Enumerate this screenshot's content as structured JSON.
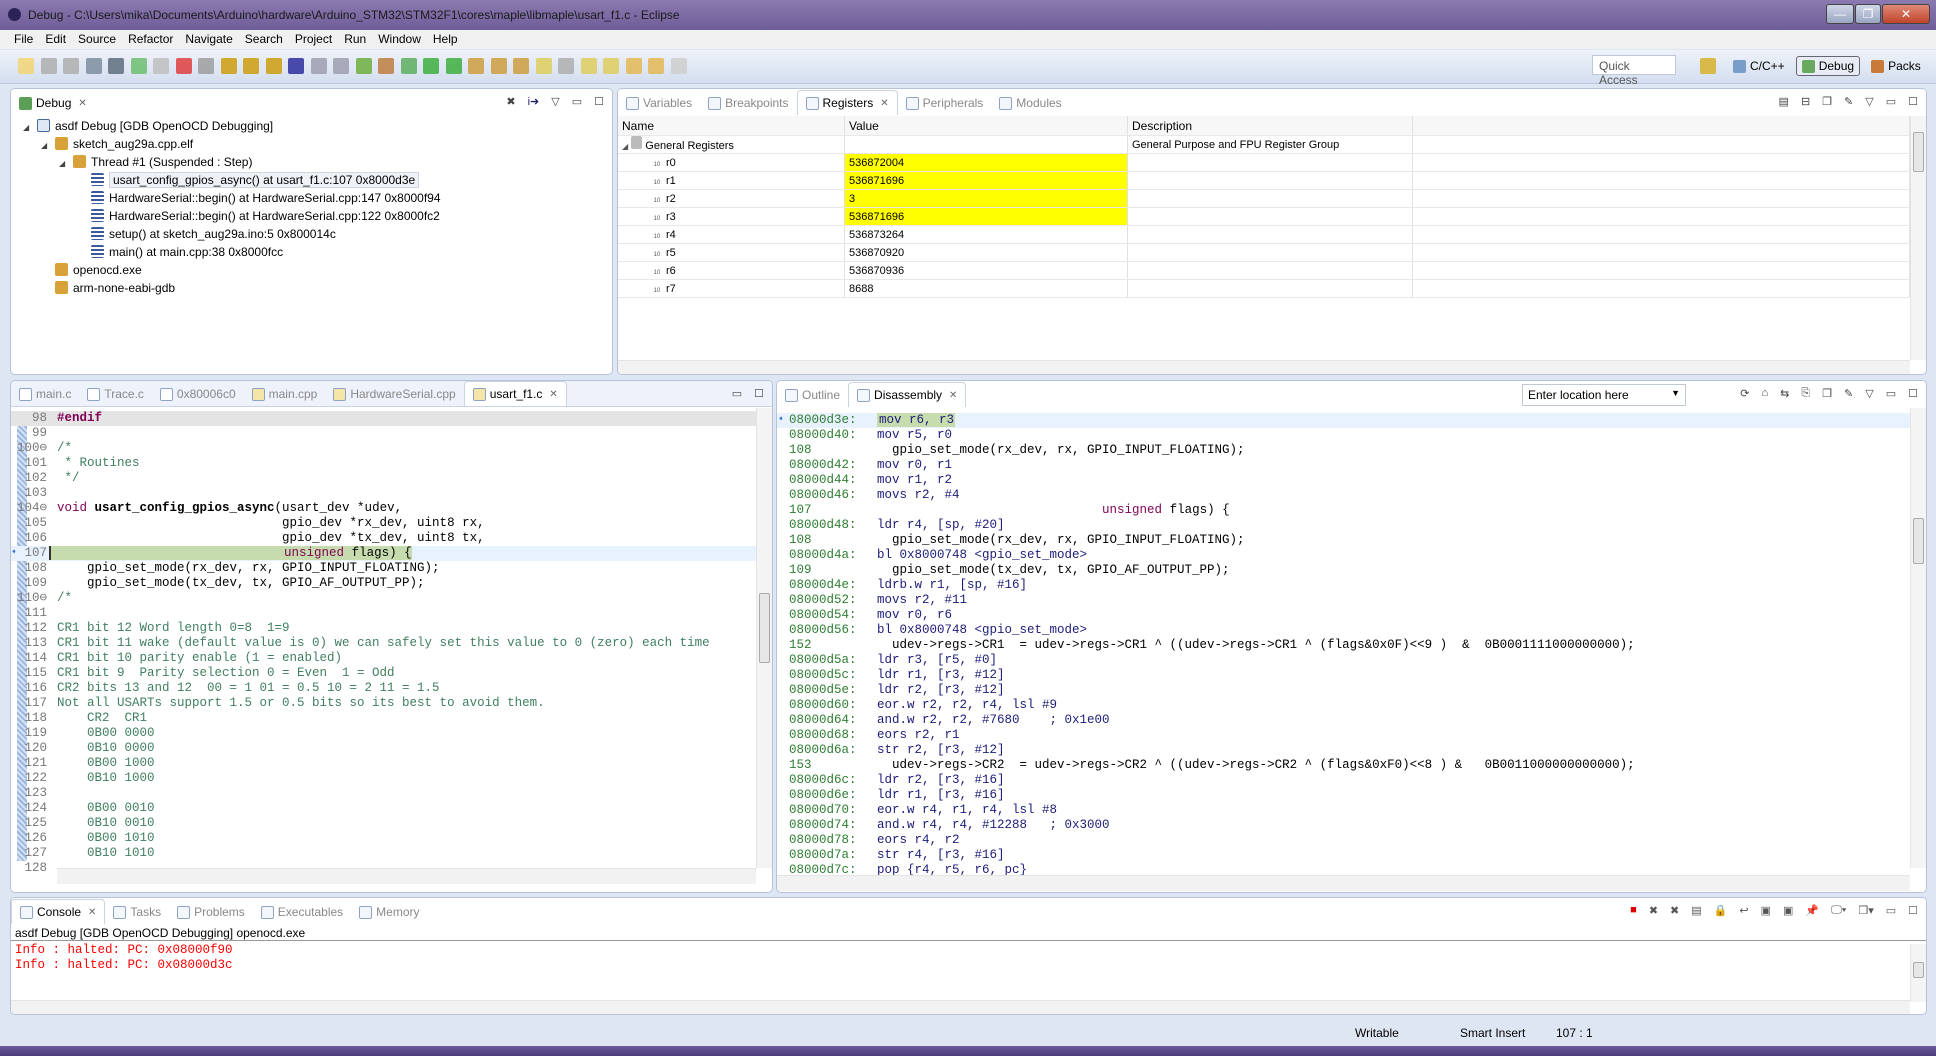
{
  "window": {
    "title": "Debug - C:\\Users\\mika\\Documents\\Arduino\\hardware\\Arduino_STM32\\STM32F1\\cores\\maple\\libmaple\\usart_f1.c - Eclipse",
    "minimize": "—",
    "restore": "❐",
    "close": "✕"
  },
  "menu": [
    "File",
    "Edit",
    "Source",
    "Refactor",
    "Navigate",
    "Search",
    "Project",
    "Run",
    "Window",
    "Help"
  ],
  "toolbar": {
    "quick_access_placeholder": "Quick Access",
    "perspectives": [
      {
        "label": "C/C++",
        "icon": "cpp-perspective-icon"
      },
      {
        "label": "Debug",
        "icon": "bug-icon",
        "active": true
      },
      {
        "label": "Packs",
        "icon": "packs-icon"
      }
    ]
  },
  "debug_view": {
    "tab": "Debug",
    "tree": [
      {
        "label": "asdf Debug [GDB OpenOCD Debugging]",
        "depth": 0,
        "icon": "c-launch-icon",
        "expanded": true
      },
      {
        "label": "sketch_aug29a.cpp.elf",
        "depth": 1,
        "icon": "process-icon",
        "expanded": true
      },
      {
        "label": "Thread #1 (Suspended : Step)",
        "depth": 2,
        "icon": "thread-icon",
        "expanded": true
      },
      {
        "label": "usart_config_gpios_async() at usart_f1.c:107 0x8000d3e",
        "depth": 3,
        "icon": "stack-frame-icon",
        "selected": true
      },
      {
        "label": "HardwareSerial::begin() at HardwareSerial.cpp:147 0x8000f94",
        "depth": 3,
        "icon": "stack-frame-icon"
      },
      {
        "label": "HardwareSerial::begin() at HardwareSerial.cpp:122 0x8000fc2",
        "depth": 3,
        "icon": "stack-frame-icon"
      },
      {
        "label": "setup() at sketch_aug29a.ino:5 0x800014c",
        "depth": 3,
        "icon": "stack-frame-icon"
      },
      {
        "label": "main() at main.cpp:38 0x8000fcc",
        "depth": 3,
        "icon": "stack-frame-icon"
      },
      {
        "label": "openocd.exe",
        "depth": 1,
        "icon": "process-icon"
      },
      {
        "label": "arm-none-eabi-gdb",
        "depth": 1,
        "icon": "process-icon"
      }
    ]
  },
  "registers_view": {
    "tabs": [
      {
        "label": "Variables",
        "icon": "variables-icon"
      },
      {
        "label": "Breakpoints",
        "icon": "breakpoints-icon"
      },
      {
        "label": "Registers",
        "icon": "registers-icon",
        "active": true
      },
      {
        "label": "Peripherals",
        "icon": "peripherals-icon"
      },
      {
        "label": "Modules",
        "icon": "modules-icon"
      }
    ],
    "columns": [
      "Name",
      "Value",
      "Description"
    ],
    "group": {
      "name": "General Registers",
      "description": "General Purpose and FPU Register Group"
    },
    "rows": [
      {
        "name": "r0",
        "value": "536872004",
        "changed": true
      },
      {
        "name": "r1",
        "value": "536871696",
        "changed": true
      },
      {
        "name": "r2",
        "value": "3",
        "changed": true
      },
      {
        "name": "r3",
        "value": "536871696",
        "changed": true
      },
      {
        "name": "r4",
        "value": "536873264"
      },
      {
        "name": "r5",
        "value": "536870920"
      },
      {
        "name": "r6",
        "value": "536870936"
      },
      {
        "name": "r7",
        "value": "8688"
      }
    ],
    "highlight_color": "#ffff00"
  },
  "editor": {
    "tabs": [
      {
        "label": "main.c"
      },
      {
        "label": "Trace.c"
      },
      {
        "label": "0x80006c0"
      },
      {
        "label": "main.cpp"
      },
      {
        "label": "HardwareSerial.cpp"
      },
      {
        "label": "usart_f1.c",
        "active": true
      }
    ],
    "current_line": 107,
    "lines": [
      {
        "n": "98",
        "segs": [
          [
            "#endif",
            "pp"
          ]
        ]
      },
      {
        "n": "99",
        "segs": []
      },
      {
        "n": "100⊖",
        "segs": [
          [
            "/*",
            "cm"
          ]
        ]
      },
      {
        "n": "101",
        "segs": [
          [
            " * Routines",
            "cm"
          ]
        ]
      },
      {
        "n": "102",
        "segs": [
          [
            " */",
            "cm"
          ]
        ]
      },
      {
        "n": "103",
        "segs": []
      },
      {
        "n": "104⊖",
        "segs": [
          [
            "void ",
            "kw"
          ],
          [
            "usart_config_gpios_async",
            "fnb"
          ],
          [
            "(usart_dev *udev,",
            ""
          ]
        ]
      },
      {
        "n": "105",
        "segs": [
          [
            "                              gpio_dev *rx_dev, uint8 rx,",
            ""
          ]
        ]
      },
      {
        "n": "106",
        "segs": [
          [
            "                              gpio_dev *tx_dev, uint8 tx,",
            ""
          ]
        ]
      },
      {
        "n": "107",
        "segs": [
          [
            "                              ",
            ""
          ],
          [
            "unsigned",
            "kw"
          ],
          [
            " flags) {",
            ""
          ]
        ],
        "current": true
      },
      {
        "n": "108",
        "segs": [
          [
            "    gpio_set_mode(rx_dev, rx, GPIO_INPUT_FLOATING);",
            ""
          ]
        ]
      },
      {
        "n": "109",
        "segs": [
          [
            "    gpio_set_mode(tx_dev, tx, GPIO_AF_OUTPUT_PP);",
            ""
          ]
        ]
      },
      {
        "n": "110⊖",
        "segs": [
          [
            "/*",
            "cm"
          ]
        ]
      },
      {
        "n": "111",
        "segs": []
      },
      {
        "n": "112",
        "segs": [
          [
            "CR1 bit 12 Word length 0=8  1=9",
            "cm"
          ]
        ]
      },
      {
        "n": "113",
        "segs": [
          [
            "CR1 bit 11 wake (default value is 0) we can safely set this value to 0 (zero) each time",
            "cm"
          ]
        ]
      },
      {
        "n": "114",
        "segs": [
          [
            "CR1 bit 10 parity enable (1 = enabled)",
            "cm"
          ]
        ]
      },
      {
        "n": "115",
        "segs": [
          [
            "CR1 bit 9  Parity selection 0 = Even  1 = Odd",
            "cm"
          ]
        ]
      },
      {
        "n": "116",
        "segs": [
          [
            "CR2 bits 13 and 12  00 = 1 01 = 0.5 10 = 2 11 = 1.5",
            "cm"
          ]
        ]
      },
      {
        "n": "117",
        "segs": [
          [
            "Not all USARTs support 1.5 or 0.5 bits so its best to avoid them.",
            "cm"
          ]
        ]
      },
      {
        "n": "118",
        "segs": [
          [
            "    CR2  CR1",
            "cm"
          ]
        ]
      },
      {
        "n": "119",
        "segs": [
          [
            "    0B00 0000",
            "cm"
          ]
        ]
      },
      {
        "n": "120",
        "segs": [
          [
            "    0B10 0000",
            "cm"
          ]
        ]
      },
      {
        "n": "121",
        "segs": [
          [
            "    0B00 1000",
            "cm"
          ]
        ]
      },
      {
        "n": "122",
        "segs": [
          [
            "    0B10 1000",
            "cm"
          ]
        ]
      },
      {
        "n": "123",
        "segs": []
      },
      {
        "n": "124",
        "segs": [
          [
            "    0B00 0010",
            "cm"
          ]
        ]
      },
      {
        "n": "125",
        "segs": [
          [
            "    0B10 0010",
            "cm"
          ]
        ]
      },
      {
        "n": "126",
        "segs": [
          [
            "    0B00 1010",
            "cm"
          ]
        ]
      },
      {
        "n": "127",
        "segs": [
          [
            "    0B10 1010",
            "cm"
          ]
        ]
      },
      {
        "n": "128",
        "segs": []
      }
    ]
  },
  "disassembly": {
    "tabs": [
      {
        "label": "Outline",
        "icon": "outline-icon"
      },
      {
        "label": "Disassembly",
        "icon": "disassembly-icon",
        "active": true
      }
    ],
    "location_placeholder": "Enter location here",
    "lines": [
      {
        "a": "08000d3e:",
        "i": "mov r6, r3",
        "current": true
      },
      {
        "a": "08000d40:",
        "i": "mov r5, r0"
      },
      {
        "a": "108",
        "s": "  gpio_set_mode(rx_dev, rx, GPIO_INPUT_FLOATING);"
      },
      {
        "a": "08000d42:",
        "i": "mov r0, r1"
      },
      {
        "a": "08000d44:",
        "i": "mov r1, r2"
      },
      {
        "a": "08000d46:",
        "i": "movs r2, #4"
      },
      {
        "a": "107",
        "s": "                              ",
        "k": "unsigned",
        "s2": " flags) {"
      },
      {
        "a": "08000d48:",
        "i": "ldr r4, [sp, #20]"
      },
      {
        "a": "108",
        "s": "  gpio_set_mode(rx_dev, rx, GPIO_INPUT_FLOATING);"
      },
      {
        "a": "08000d4a:",
        "i": "bl 0x8000748 <gpio_set_mode>"
      },
      {
        "a": "109",
        "s": "  gpio_set_mode(tx_dev, tx, GPIO_AF_OUTPUT_PP);"
      },
      {
        "a": "08000d4e:",
        "i": "ldrb.w r1, [sp, #16]"
      },
      {
        "a": "08000d52:",
        "i": "movs r2, #11"
      },
      {
        "a": "08000d54:",
        "i": "mov r0, r6"
      },
      {
        "a": "08000d56:",
        "i": "bl 0x8000748 <gpio_set_mode>"
      },
      {
        "a": "152",
        "s": "  udev->regs->CR1  = udev->regs->CR1 ^ ((udev->regs->CR1 ^ (flags&0x0F)<<9 )  &  0B0001111000000000);"
      },
      {
        "a": "08000d5a:",
        "i": "ldr r3, [r5, #0]"
      },
      {
        "a": "08000d5c:",
        "i": "ldr r1, [r3, #12]"
      },
      {
        "a": "08000d5e:",
        "i": "ldr r2, [r3, #12]"
      },
      {
        "a": "08000d60:",
        "i": "eor.w r2, r2, r4, lsl #9"
      },
      {
        "a": "08000d64:",
        "i": "and.w r2, r2, #7680    ; 0x1e00"
      },
      {
        "a": "08000d68:",
        "i": "eors r2, r1"
      },
      {
        "a": "08000d6a:",
        "i": "str r2, [r3, #12]"
      },
      {
        "a": "153",
        "s": "  udev->regs->CR2  = udev->regs->CR2 ^ ((udev->regs->CR2 ^ (flags&0xF0)<<8 ) &   0B0011000000000000);"
      },
      {
        "a": "08000d6c:",
        "i": "ldr r2, [r3, #16]"
      },
      {
        "a": "08000d6e:",
        "i": "ldr r1, [r3, #16]"
      },
      {
        "a": "08000d70:",
        "i": "eor.w r4, r1, r4, lsl #8"
      },
      {
        "a": "08000d74:",
        "i": "and.w r4, r4, #12288   ; 0x3000"
      },
      {
        "a": "08000d78:",
        "i": "eors r4, r2"
      },
      {
        "a": "08000d7a:",
        "i": "str r4, [r3, #16]"
      },
      {
        "a": "08000d7c:",
        "i": "pop {r4, r5, r6, pc}"
      }
    ]
  },
  "console": {
    "tabs": [
      {
        "label": "Console",
        "icon": "console-icon",
        "active": true
      },
      {
        "label": "Tasks",
        "icon": "tasks-icon"
      },
      {
        "label": "Problems",
        "icon": "problems-icon"
      },
      {
        "label": "Executables",
        "icon": "executables-icon"
      },
      {
        "label": "Memory",
        "icon": "memory-icon"
      }
    ],
    "process": "asdf Debug [GDB OpenOCD Debugging] openocd.exe",
    "lines": [
      "Info : halted: PC: 0x08000f90",
      "Info : halted: PC: 0x08000d3c"
    ],
    "error_color": "#ff0000"
  },
  "status": {
    "writable": "Writable",
    "insert_mode": "Smart Insert",
    "position": "107 : 1"
  },
  "colors": {
    "current_line": "#c7dcae",
    "line_highlight": "#e8f2fe",
    "comment": "#3f7f5f",
    "keyword": "#7f0055"
  }
}
